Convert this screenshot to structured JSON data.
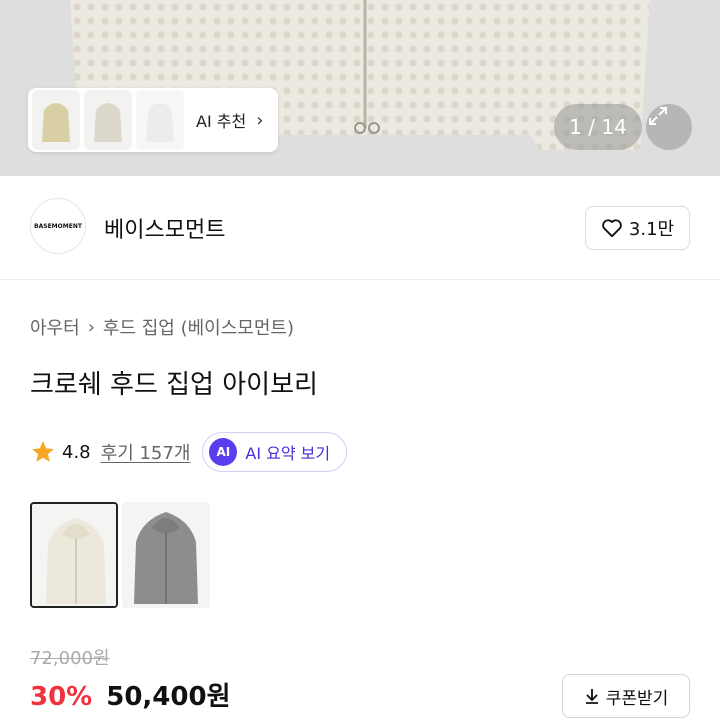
{
  "gallery": {
    "ai_recommend_label": "AI 추천",
    "ai_recommend_chevron": "›",
    "counter": "1 / 14",
    "expand_icon": "expand-icon"
  },
  "brand": {
    "logo_text": "BASEMOMENT",
    "name": "베이스모먼트",
    "like_count": "3.1만"
  },
  "product": {
    "breadcrumb": [
      "아우터",
      "후드 집업 (베이스모먼트)"
    ],
    "breadcrumb_separator": "›",
    "title": "크로쉐 후드 집업 아이보리",
    "rating": "4.8",
    "reviews": "후기 157개",
    "ai_summary_badge": "AI",
    "ai_summary_label": "AI 요약 보기",
    "colors": [
      "ivory",
      "gray"
    ],
    "original_price": "72,000원",
    "discount": "30%",
    "price": "50,400원",
    "coupon_label": "쿠폰받기"
  },
  "colors": {
    "discount_red": "#f0323c",
    "ai_purple": "#5b3df0"
  }
}
